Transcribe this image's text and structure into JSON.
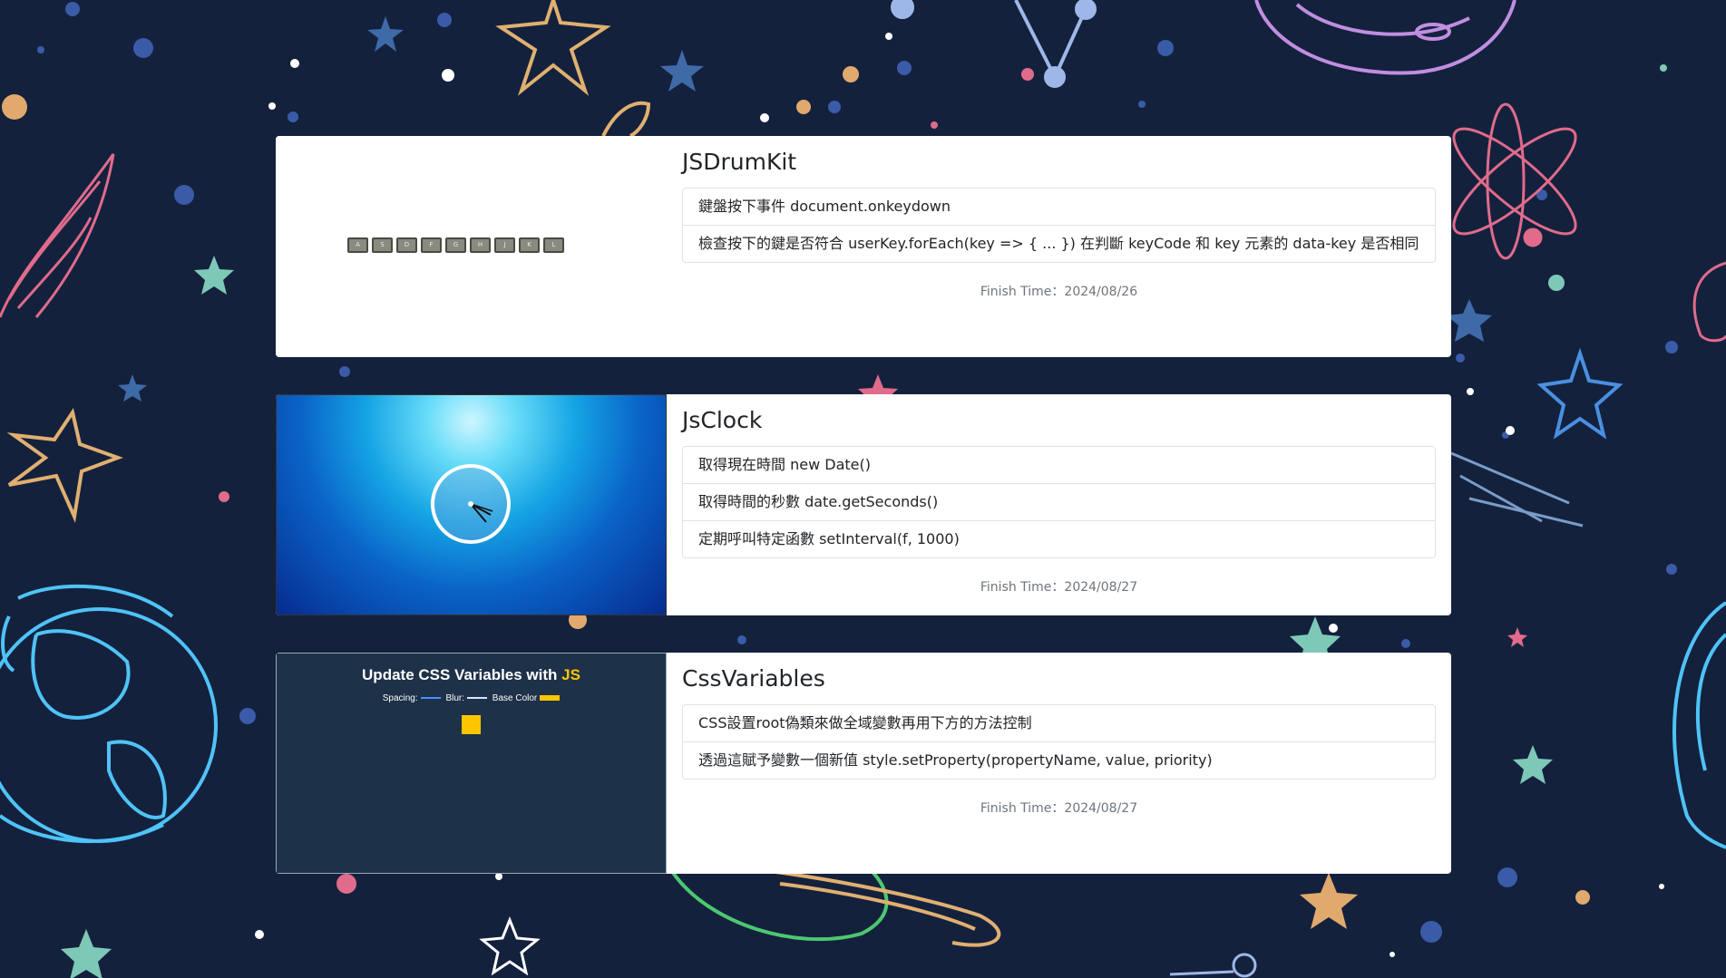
{
  "colors": {
    "background": "#14213d",
    "card": "#ffffff",
    "accent_yellow": "#ffc600"
  },
  "projects": [
    {
      "title": "JSDrumKit",
      "keys": [
        "A",
        "S",
        "D",
        "F",
        "G",
        "H",
        "J",
        "K",
        "L"
      ],
      "items": [
        "鍵盤按下事件 document.onkeydown",
        "檢查按下的鍵是否符合 userKey.forEach(key => { ... }) 在判斷 keyCode 和 key 元素的 data-key 是否相同"
      ],
      "finish": "Finish Time：2024/08/26"
    },
    {
      "title": "JsClock",
      "items": [
        "取得現在時間 new Date()",
        "取得時間的秒數 date.getSeconds()",
        "定期呼叫特定函數 setInterval(f, 1000)"
      ],
      "finish": "Finish Time：2024/08/27"
    },
    {
      "title": "CssVariables",
      "thumb_title_main": "Update CSS Variables with ",
      "thumb_title_highlight": "JS",
      "spacing_label": "Spacing:",
      "blur_label": "Blur:",
      "base_color_label": "Base Color",
      "items": [
        "CSS設置root偽類來做全域變數再用下方的方法控制",
        "透過這賦予變數一個新值 style.setProperty(propertyName, value, priority)"
      ],
      "finish": "Finish Time：2024/08/27"
    }
  ]
}
